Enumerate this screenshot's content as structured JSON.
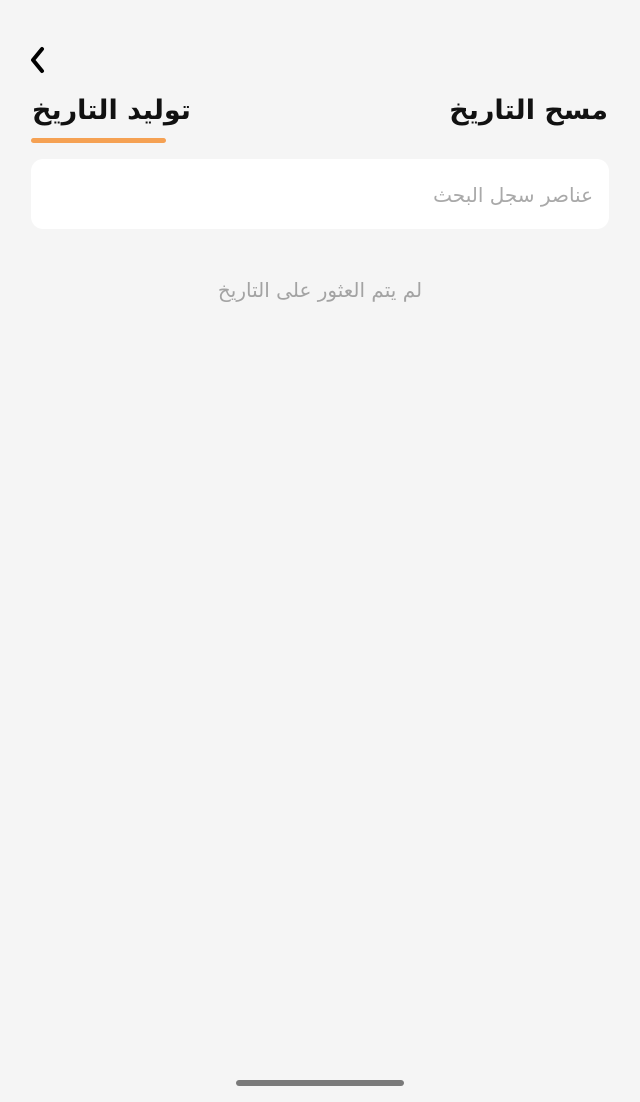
{
  "header": {
    "back_icon": "chevron-left-icon"
  },
  "tabs": [
    {
      "label": "توليد التاريخ",
      "active": true
    },
    {
      "label": "مسح التاريخ",
      "active": false
    }
  ],
  "search": {
    "placeholder": "عناصر سجل البحث",
    "value": ""
  },
  "empty_state": {
    "message": "لم يتم العثور على التاريخ"
  },
  "colors": {
    "background": "#f5f5f5",
    "accent": "#f5a153",
    "text_primary": "#111111",
    "text_muted": "#a3a3a3"
  }
}
